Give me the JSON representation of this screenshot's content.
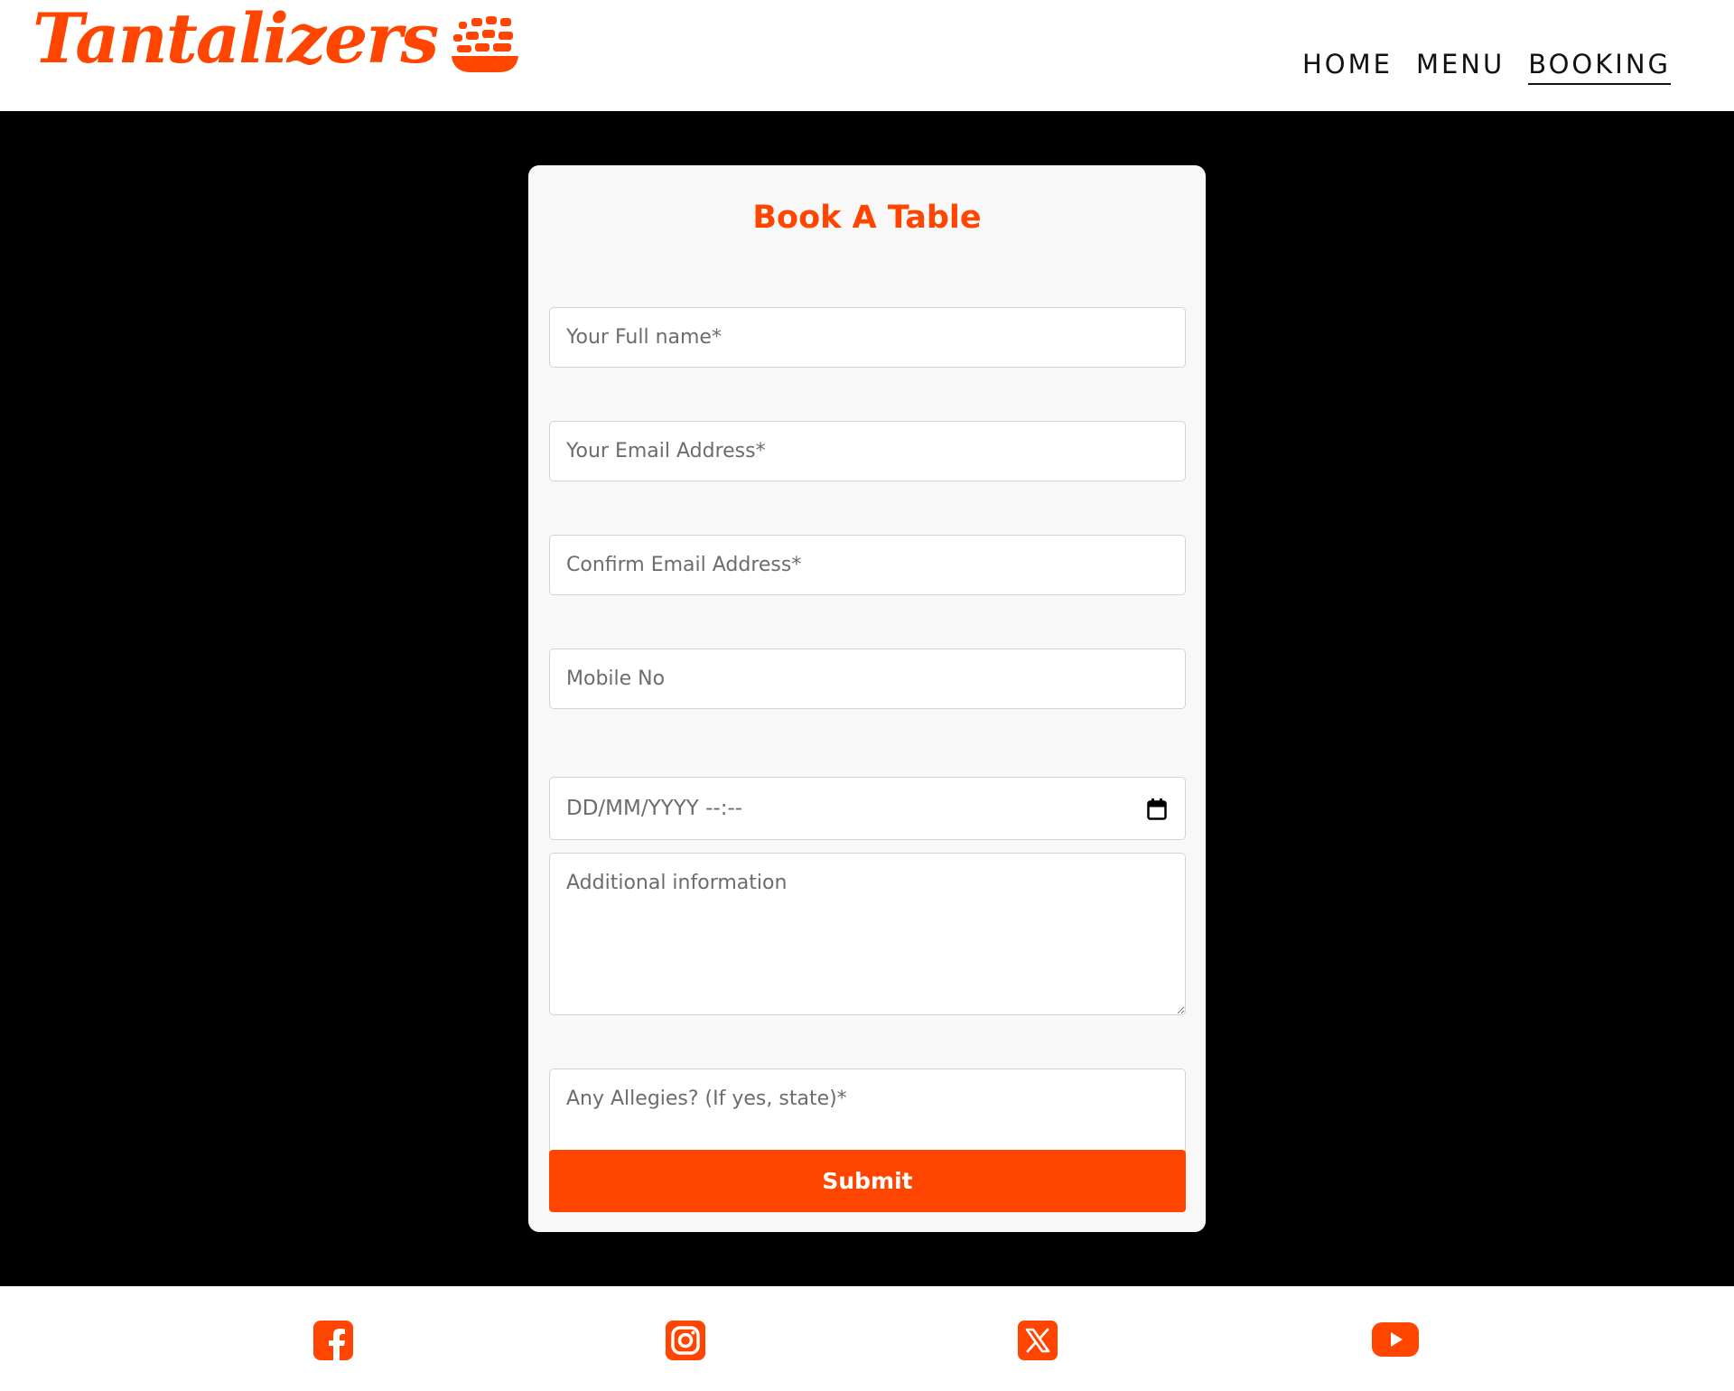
{
  "brand": {
    "name": "Tantalizers",
    "logo_icon": "bowl-with-steam-icon",
    "accent_color": "#ff4500"
  },
  "nav": {
    "items": [
      {
        "label": "HOME",
        "active": false
      },
      {
        "label": "MENU",
        "active": false
      },
      {
        "label": "BOOKING",
        "active": true
      }
    ]
  },
  "form": {
    "title": "Book A Table",
    "full_name_placeholder": "Your Full name*",
    "email_placeholder": "Your Email Address*",
    "confirm_email_placeholder": "Confirm Email Address*",
    "mobile_placeholder": "Mobile No",
    "datetime_placeholder": "DD/MM/YYYY  --:--",
    "datetime_icon": "calendar-icon",
    "additional_info_placeholder": "Additional information",
    "allergies_placeholder": "Any Allegies? (If yes, state)*",
    "submit_label": "Submit"
  },
  "footer": {
    "social": [
      {
        "name": "facebook-icon"
      },
      {
        "name": "instagram-icon"
      },
      {
        "name": "x-twitter-icon"
      },
      {
        "name": "youtube-icon"
      }
    ]
  },
  "colors": {
    "accent": "#ff4500",
    "page_background": "#000000",
    "card_background": "#f8f8f8"
  }
}
